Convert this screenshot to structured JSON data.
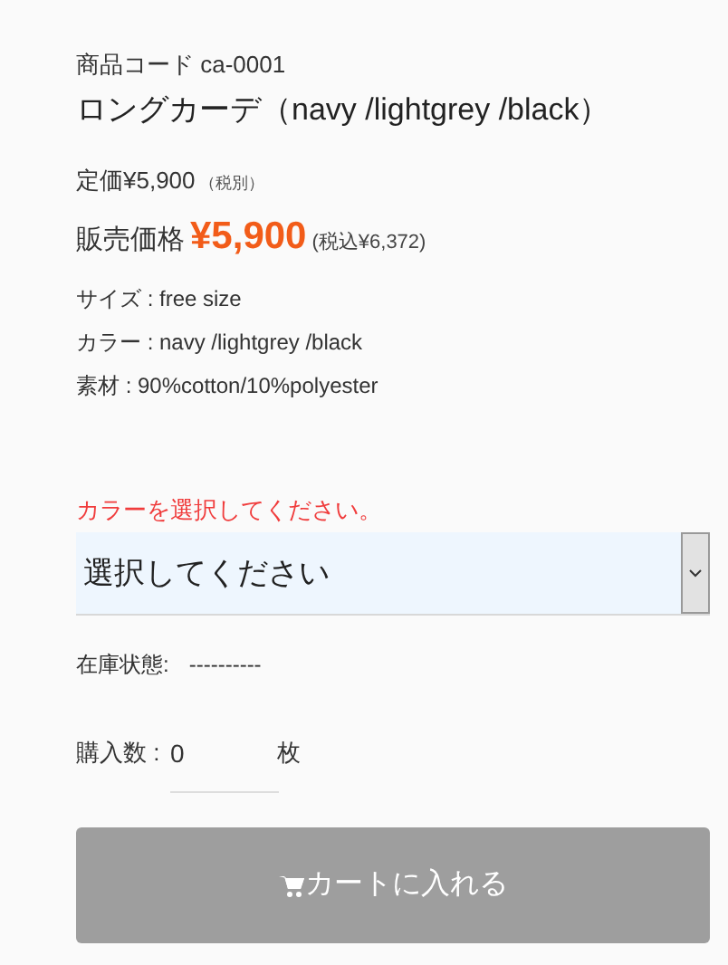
{
  "product_code": {
    "label": "商品コード",
    "value": "ca-0001"
  },
  "title": "ロングカーデ（navy /lightgrey /black）",
  "list_price": {
    "label": "定価",
    "value": "¥5,900",
    "note": "（税別）"
  },
  "sale_price": {
    "label": "販売価格",
    "value": "¥5,900",
    "tax_included": "(税込¥6,372)"
  },
  "specs": [
    {
      "label": "サイズ : ",
      "value": "free size"
    },
    {
      "label": "カラー : ",
      "value": "navy /lightgrey /black"
    },
    {
      "label": "素材 : ",
      "value": "90%cotton/10%polyester"
    }
  ],
  "color_error": "カラーを選択してください。",
  "color_select": {
    "value": "選択してください"
  },
  "stock": {
    "label": "在庫状態:",
    "value": "----------"
  },
  "quantity": {
    "label": "購入数 :",
    "value": "0",
    "unit": "枚"
  },
  "cart_button": {
    "label": "カートに入れる",
    "disabled": true
  }
}
